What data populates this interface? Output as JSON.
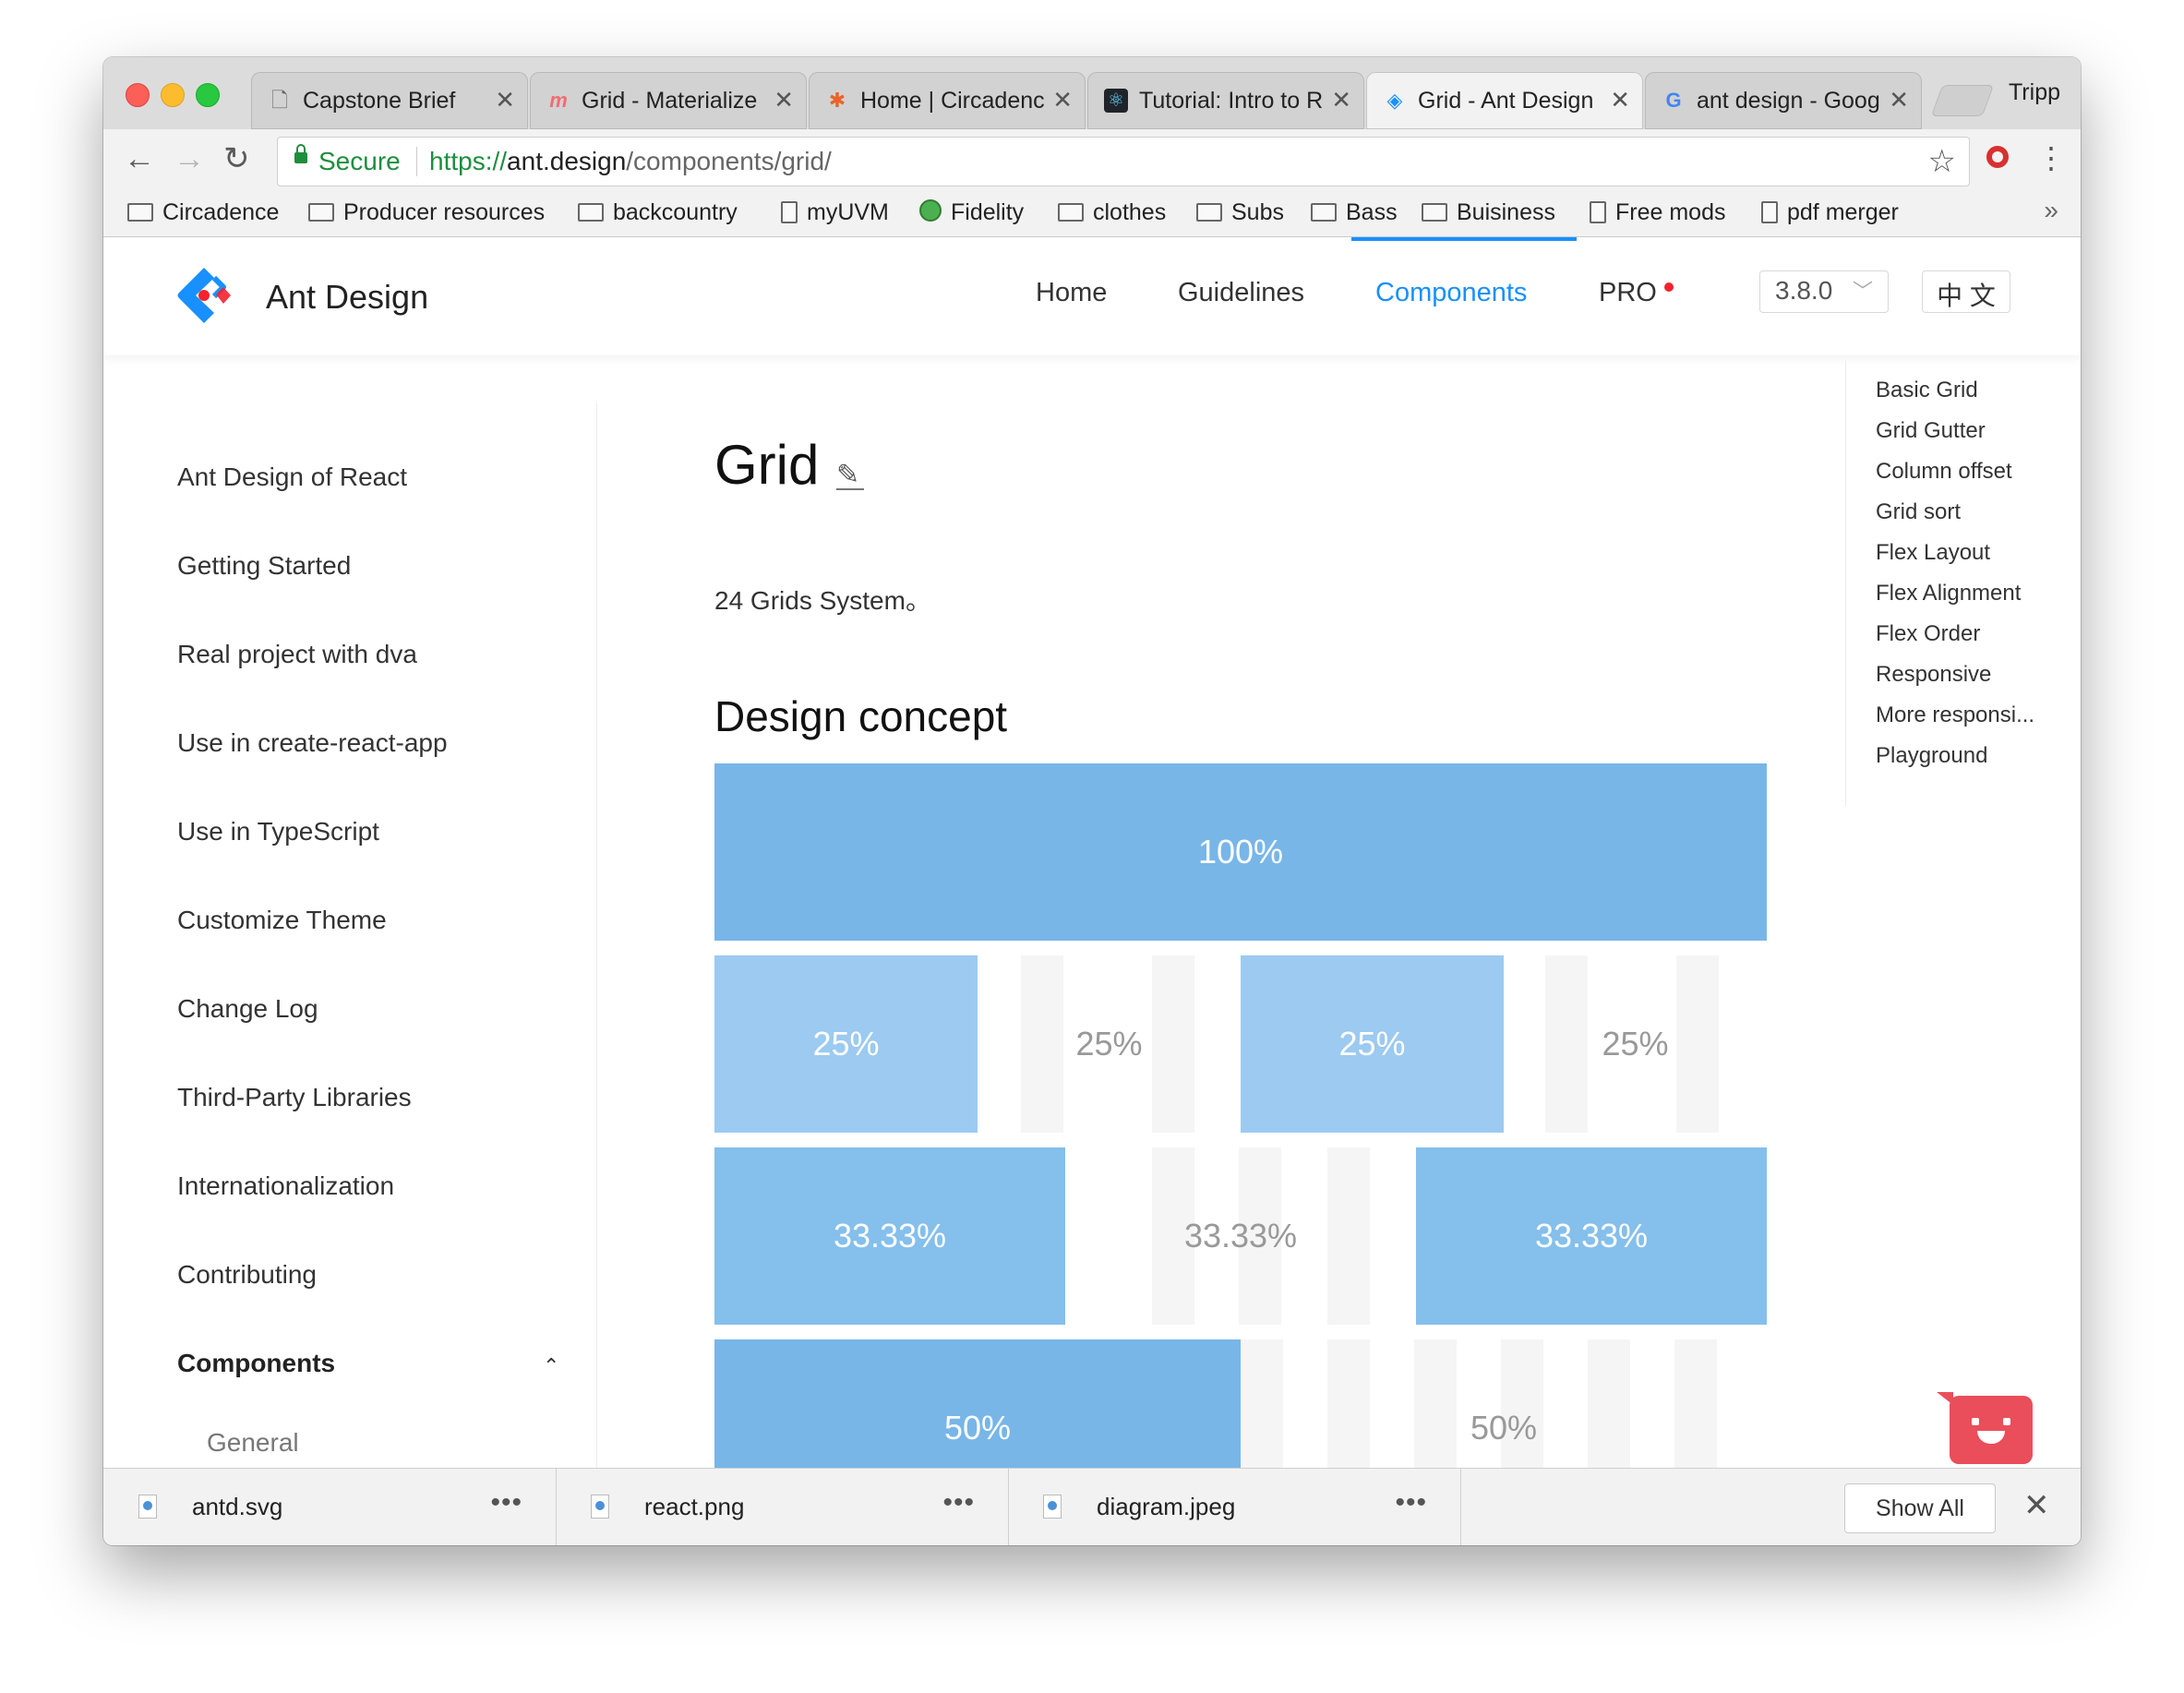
{
  "browser": {
    "tabs": [
      {
        "title": "Capstone Brief",
        "icon": "document-icon"
      },
      {
        "title": "Grid - Materialize",
        "icon": "materialize-icon"
      },
      {
        "title": "Home | Circadence",
        "icon": "circadence-icon"
      },
      {
        "title": "Tutorial: Intro to React",
        "icon": "react-icon"
      },
      {
        "title": "Grid - Ant Design",
        "icon": "ant-design-icon",
        "active": true
      },
      {
        "title": "ant design - Google Search",
        "icon": "google-icon"
      }
    ],
    "close_glyph": "✕",
    "profile_name": "Tripp",
    "nav": {
      "back": "←",
      "forward": "→",
      "reload": "↻"
    },
    "address": {
      "secure_label": "Secure",
      "scheme": "https://",
      "domain": "ant.design",
      "path": "/components/grid/"
    },
    "bookmarks": [
      {
        "label": "Circadence",
        "type": "folder"
      },
      {
        "label": "Producer resources",
        "type": "folder"
      },
      {
        "label": "backcountry",
        "type": "folder"
      },
      {
        "label": "myUVM",
        "type": "file"
      },
      {
        "label": "Fidelity",
        "type": "site"
      },
      {
        "label": "clothes",
        "type": "folder"
      },
      {
        "label": "Subs",
        "type": "folder"
      },
      {
        "label": "Bass",
        "type": "folder"
      },
      {
        "label": "Buisiness",
        "type": "folder"
      },
      {
        "label": "Free mods",
        "type": "file"
      },
      {
        "label": "pdf merger",
        "type": "file"
      }
    ],
    "bookmarks_more": "»"
  },
  "site": {
    "brand": "Ant Design",
    "menu": [
      "Home",
      "Guidelines",
      "Components",
      "PRO"
    ],
    "active_menu": "Components",
    "version": "3.8.0",
    "language": "中 文",
    "accent": "#1890ff"
  },
  "sidebar": {
    "items": [
      "Ant Design of React",
      "Getting Started",
      "Real project with dva",
      "Use in create-react-app",
      "Use in TypeScript",
      "Customize Theme",
      "Change Log",
      "Third-Party Libraries",
      "Internationalization",
      "Contributing"
    ],
    "group": "Components",
    "group_caret": "⌃",
    "subgroup": "General"
  },
  "content": {
    "title": "Grid",
    "subtitle": "24 Grids System。",
    "section_title": "Design concept",
    "grid_rows": [
      [
        "100%"
      ],
      [
        "25%",
        "25%",
        "25%",
        "25%"
      ],
      [
        "33.33%",
        "33.33%",
        "33.33%"
      ],
      [
        "50%",
        "50%"
      ]
    ]
  },
  "toc": [
    "Basic Grid",
    "Grid Gutter",
    "Column offset",
    "Grid sort",
    "Flex Layout",
    "Flex Alignment",
    "Flex Order",
    "Responsive",
    "More responsi...",
    "Playground"
  ],
  "downloads": {
    "files": [
      "antd.svg",
      "react.png",
      "diagram.jpeg"
    ],
    "more_glyph": "•••",
    "show_all": "Show All",
    "close_glyph": "✕"
  }
}
